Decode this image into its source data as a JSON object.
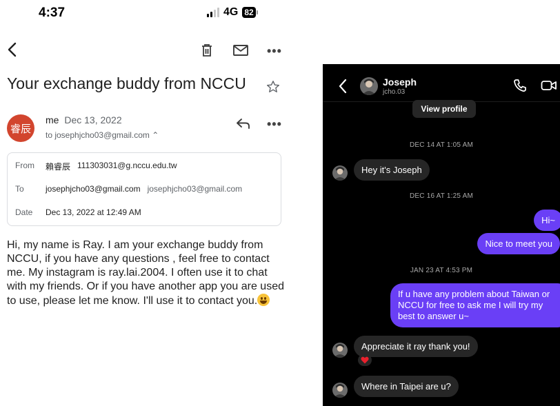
{
  "email": {
    "status": {
      "time": "4:37",
      "network": "4G",
      "battery": "82"
    },
    "subject": "Your exchange buddy from NCCU",
    "sender": {
      "avatar_text": "睿辰",
      "name": "me",
      "date": "Dec 13, 2022",
      "recipient_line": "to josephjcho03@gmail.com ⌃"
    },
    "details": {
      "from_label": "From",
      "from_name": "賴睿辰",
      "from_email": "111303031@g.nccu.edu.tw",
      "to_label": "To",
      "to_value": "josephjcho03@gmail.com",
      "to_value2": "josephjcho03@gmail.com",
      "date_label": "Date",
      "date_value": "Dec 13, 2022 at 12:49 AM"
    },
    "body": "Hi, my name is Ray. I am your exchange buddy from NCCU, if you have any questions , feel free to contact me. My instagram is ray.lai.2004. I often use it to chat with my friends. Or if you have another app you are used to use, please let me know. I'll use it to contact you.",
    "colors": {
      "avatar": "#d2452e",
      "border": "#dadce0"
    }
  },
  "dm": {
    "contact_name": "Joseph",
    "contact_handle": "jcho.03",
    "view_profile": "View profile",
    "ts1": "DEC 14 AT 1:05 AM",
    "msg1": "Hey it's Joseph",
    "ts2": "DEC 16 AT 1:25 AM",
    "out1": "Hi~",
    "out2": "Nice to meet you",
    "ts3": "JAN 23 AT 4:53 PM",
    "out3": "If u have any problem about Taiwan or NCCU for free to ask me I will try my best to answer u~",
    "msg2": "Appreciate it ray thank you!",
    "reaction": "heart-emoji",
    "msg3": "Where in Taipei are u?",
    "colors": {
      "outgoing": "#6a3ff6",
      "incoming": "#262626",
      "background": "#000000"
    }
  }
}
